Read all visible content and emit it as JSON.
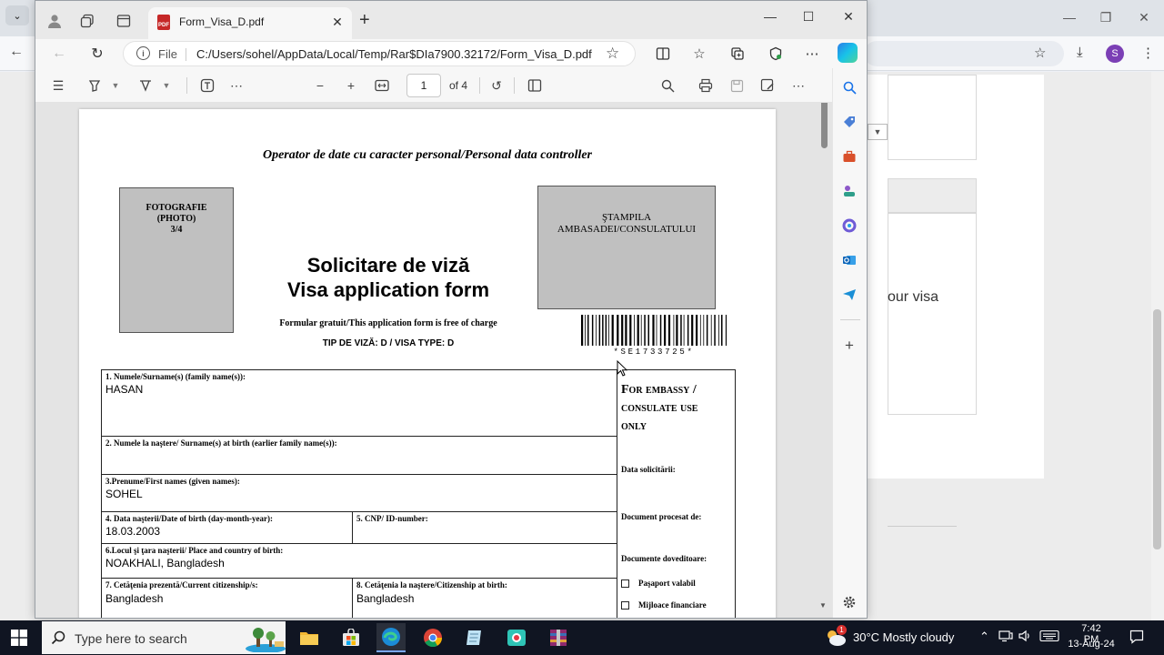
{
  "background_browser": {
    "card_text": "our visa"
  },
  "tab": {
    "title": "Form_Visa_D.pdf",
    "pdf_icon_text": "PDF"
  },
  "address": {
    "scheme_label": "File",
    "url": "C:/Users/sohel/AppData/Local/Temp/Rar$DIa7900.32172/Form_Visa_D.pdf"
  },
  "profile_initial": "S",
  "pdf_toolbar": {
    "page_current": "1",
    "page_total": "of 4"
  },
  "document": {
    "controller_line": "Operator de date cu caracter personal/Personal data controller",
    "photo_box": [
      "FOTOGRAFIE",
      "(PHOTO)",
      "3/4"
    ],
    "stamp_box": [
      "ŞTAMPILA",
      "AMBASADEI/CONSULATULUI"
    ],
    "title_ro": "Solicitare de viză",
    "title_en": "Visa application form",
    "free_line": "Formular gratuit/This application form is free of charge",
    "visa_type_line": "TIP DE VIZĂ: D / VISA TYPE: D",
    "barcode_text": "*SE1733725*",
    "fields": {
      "surname": {
        "label": "1. Numele/Surname(s) (family name(s)):",
        "value": "HASAN"
      },
      "birth_surname": {
        "label": "2. Numele la naştere/ Surname(s) at birth (earlier family name(s)):",
        "value": ""
      },
      "first_names": {
        "label": "3.Prenume/First names (given names):",
        "value": "SOHEL"
      },
      "dob": {
        "label": "4. Data naşterii/Date of birth (day-month-year):",
        "value": "18.03.2003"
      },
      "cnp": {
        "label": "5. CNP/ ID-number:",
        "value": ""
      },
      "birth_place": {
        "label": "6.Locul şi ţara naşterii/ Place and country of birth:",
        "value": "NOAKHALI, Bangladesh"
      },
      "citizenship": {
        "label": "7. Cetăţenia prezentă/Current citizenship/s:",
        "value": "Bangladesh"
      },
      "citizenship_birth": {
        "label": "8. Cetăţenia la naştere/Citizenship at birth:",
        "value": "Bangladesh"
      }
    },
    "embassy": {
      "title_lines": [
        "For embassy /",
        "consulate use",
        "only"
      ],
      "date_label": "Data solicitării:",
      "processed_label": "Document procesat de:",
      "supporting_label": "Documente doveditoare:",
      "checks": [
        "Paşaport valabil",
        "Mijloace financiare"
      ]
    }
  },
  "taskbar": {
    "search_placeholder": "Type here to search",
    "weather": "30°C  Mostly cloudy",
    "weather_badge": "1",
    "time": "7:42 PM",
    "date": "13-Aug-24"
  },
  "colors": {
    "accent": "#1a73e8",
    "pdf_red": "#c62828",
    "taskbar": "#101522",
    "profile": "#7b3fb5"
  }
}
